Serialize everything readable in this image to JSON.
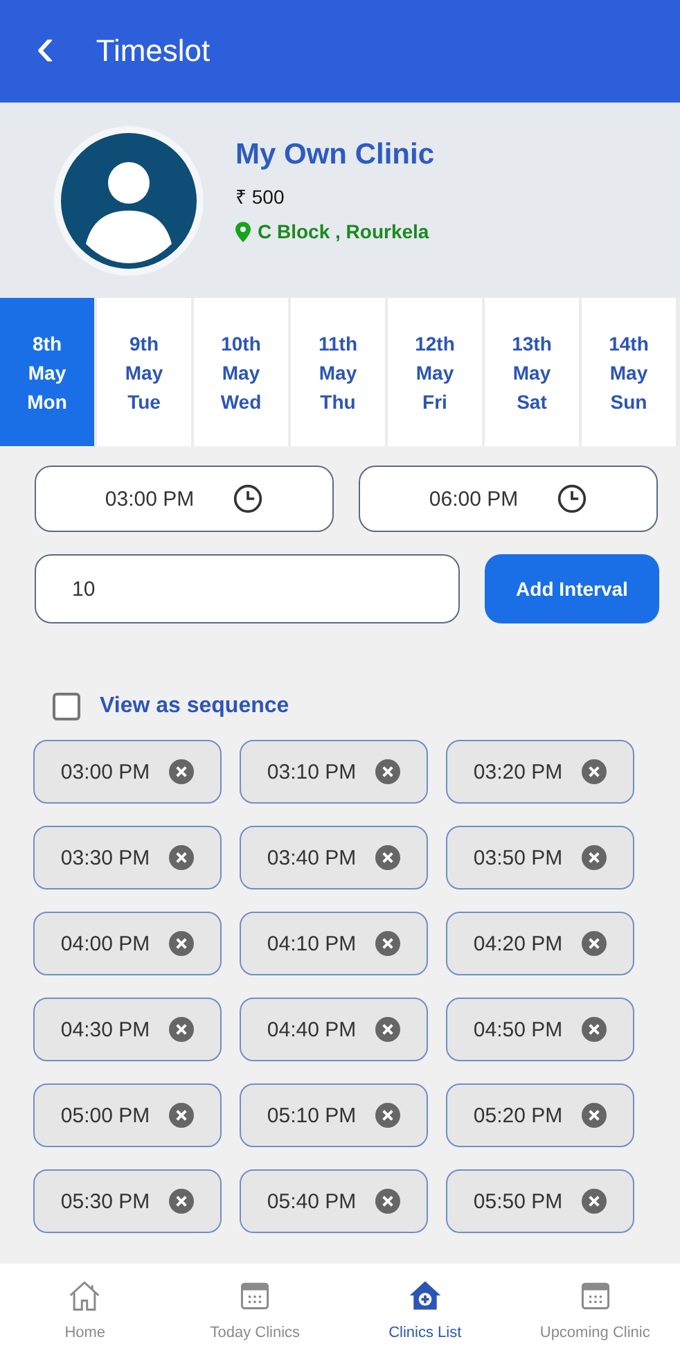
{
  "header": {
    "back_icon": "‹",
    "title": "Timeslot"
  },
  "clinic": {
    "name": "My Own Clinic",
    "fee": "₹ 500",
    "location": "C Block , Rourkela"
  },
  "dates": [
    {
      "day": "8th",
      "month": "May",
      "weekday": "Mon",
      "selected": true
    },
    {
      "day": "9th",
      "month": "May",
      "weekday": "Tue",
      "selected": false
    },
    {
      "day": "10th",
      "month": "May",
      "weekday": "Wed",
      "selected": false
    },
    {
      "day": "11th",
      "month": "May",
      "weekday": "Thu",
      "selected": false
    },
    {
      "day": "12th",
      "month": "May",
      "weekday": "Fri",
      "selected": false
    },
    {
      "day": "13th",
      "month": "May",
      "weekday": "Sat",
      "selected": false
    },
    {
      "day": "14th",
      "month": "May",
      "weekday": "Sun",
      "selected": false
    }
  ],
  "start_time": "03:00 PM",
  "end_time": "06:00 PM",
  "interval": "10",
  "add_button": "Add Interval",
  "sequence": {
    "label": "View as sequence",
    "checked": false
  },
  "slots": [
    "03:00 PM",
    "03:10 PM",
    "03:20 PM",
    "03:30 PM",
    "03:40 PM",
    "03:50 PM",
    "04:00 PM",
    "04:10 PM",
    "04:20 PM",
    "04:30 PM",
    "04:40 PM",
    "04:50 PM",
    "05:00 PM",
    "05:10 PM",
    "05:20 PM",
    "05:30 PM",
    "05:40 PM",
    "05:50 PM"
  ],
  "nav": [
    {
      "kind": "home",
      "label": "Home",
      "selected": false
    },
    {
      "kind": "calendar",
      "label": "Today Clinics",
      "selected": false
    },
    {
      "kind": "clinic",
      "label": "Clinics List",
      "selected": true
    },
    {
      "kind": "calendar",
      "label": "Upcoming Clinic",
      "selected": false
    }
  ]
}
